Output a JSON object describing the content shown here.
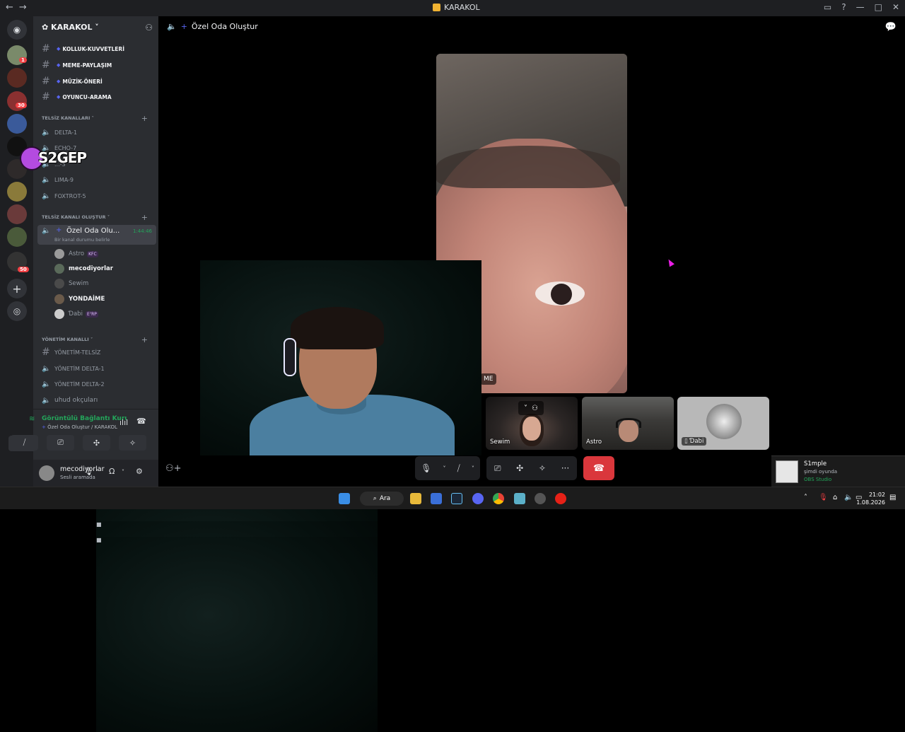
{
  "window": {
    "title": "KARAKOL",
    "nav_back": "←",
    "nav_forward": "→"
  },
  "server": {
    "name": "KARAKOL ˅"
  },
  "text_channels": [
    {
      "name": "KOLLUK-KUVVETLERİ"
    },
    {
      "name": "MEME-PAYLAŞIM"
    },
    {
      "name": "MÜZİK-ÖNERİ"
    },
    {
      "name": "OYUNCU-ARAMA"
    }
  ],
  "categories": {
    "telsiz": "TELSİZ KANALLARI ˅",
    "olustur": "TELSİZ KANALI OLUŞTUR ˅",
    "yonetim": "YÖNETİM KANALLI ˅"
  },
  "voice_channels": [
    {
      "name": "DELTA-1"
    },
    {
      "name": "ECHO-7"
    },
    {
      "name": "...-3"
    },
    {
      "name": "LIMA-9"
    },
    {
      "name": "FOXTROT-5"
    }
  ],
  "active_channel": {
    "name": "Özel Oda Olu...",
    "timer": "1:44:46",
    "status": "Bir kanal durumu belirle"
  },
  "members": [
    {
      "name": "Astro",
      "tag": "KFC"
    },
    {
      "name": "mecodiyorlar",
      "tag": ""
    },
    {
      "name": "Sewim",
      "tag": ""
    },
    {
      "name": "YONDAİME",
      "tag": ""
    },
    {
      "name": "Ɗabi",
      "tag": "E⁷RP"
    }
  ],
  "yonetim_channels": [
    {
      "name": "YÖNETİM-TELSİZ"
    },
    {
      "name": "YÖNETİM DELTA-1"
    },
    {
      "name": "YÖNETİM DELTA-2"
    },
    {
      "name": "uhud okçuları"
    }
  ],
  "voice_panel": {
    "status": "Görüntülü Bağlantı Kuruldu",
    "sub": "Özel Oda Oluştur / KARAKOL"
  },
  "user_panel": {
    "name": "mecodiyorlar",
    "status": "Sesli aramada"
  },
  "call": {
    "header": "Özel Oda Oluştur",
    "big_tile_name": "ME",
    "tiles": [
      {
        "name": "Sewim"
      },
      {
        "name": "Astro"
      },
      {
        "name": "Ɗabi"
      }
    ]
  },
  "overlay": {
    "text": "S2GEP"
  },
  "guild_badges": [
    "1",
    "30",
    "50"
  ],
  "notification": {
    "title": "S1mple",
    "line": "şimdi oyunda",
    "app": "OBS Studio"
  },
  "taskbar": {
    "search": "Ara",
    "time": "21:02",
    "date": "1.08.2026"
  },
  "colors": {
    "blurple": "#5865f2",
    "green": "#23a55a",
    "red": "#da373c"
  }
}
